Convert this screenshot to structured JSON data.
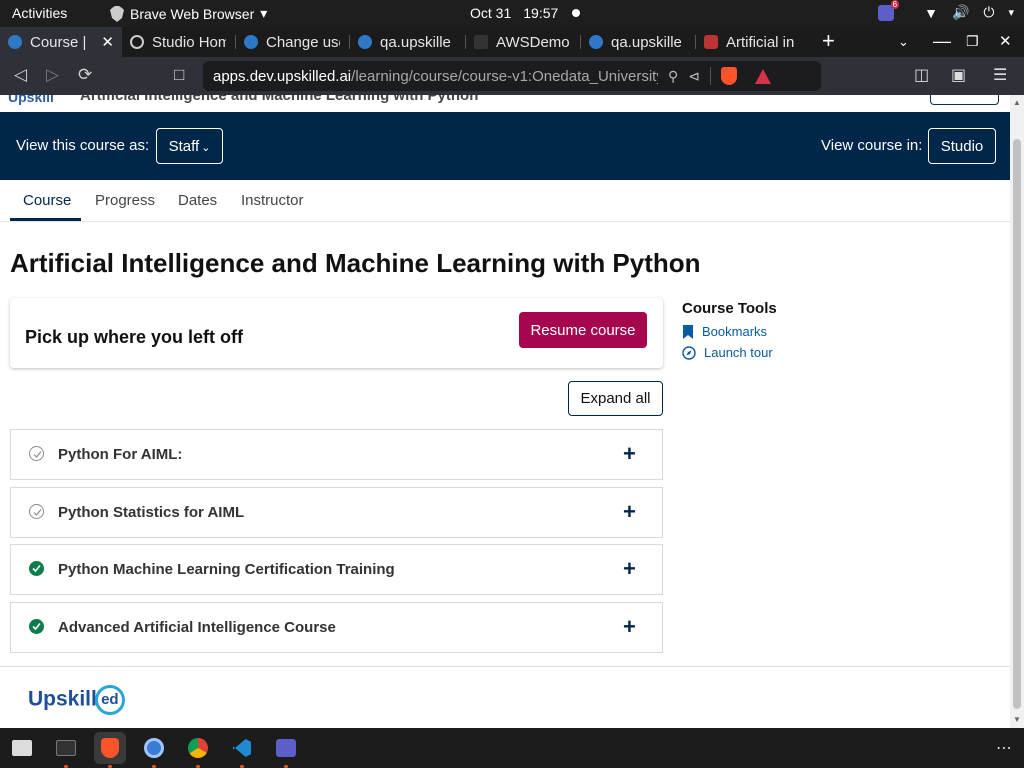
{
  "system": {
    "activities": "Activities",
    "app_name": "Brave Web Browser",
    "date": "Oct 31",
    "time": "19:57",
    "teams_badge": "6"
  },
  "browser": {
    "tabs": [
      {
        "title": "Course |",
        "active": true
      },
      {
        "title": "Studio Hom"
      },
      {
        "title": "Change use"
      },
      {
        "title": "qa.upskille"
      },
      {
        "title": "AWSDemo"
      },
      {
        "title": "qa.upskille"
      },
      {
        "title": "Artificial in"
      }
    ],
    "url_host": "apps.dev.upskilled.ai",
    "url_path": "/learning/course/course-v1:Onedata_University..."
  },
  "page": {
    "header_course_name": "Artificial Intelligence and Machine Learning with Python",
    "staff_bar": {
      "view_as_label": "View this course as:",
      "view_as_value": "Staff",
      "view_in_label": "View course in:",
      "studio_button": "Studio"
    },
    "tabs": [
      "Course",
      "Progress",
      "Dates",
      "Instructor"
    ],
    "title": "Artificial Intelligence and Machine Learning with Python",
    "resume_card": {
      "text": "Pick up where you left off",
      "button": "Resume course"
    },
    "expand_all": "Expand all",
    "sections": [
      {
        "name": "Python For AIML:",
        "complete": false
      },
      {
        "name": "Python Statistics for AIML",
        "complete": false
      },
      {
        "name": "Python Machine Learning Certification Training",
        "complete": true
      },
      {
        "name": "Advanced Artificial Intelligence Course",
        "complete": true
      }
    ],
    "course_tools": {
      "heading": "Course Tools",
      "items": [
        "Bookmarks",
        "Launch tour"
      ]
    },
    "footer_logo": "Upskill",
    "footer_logo_ed": "ed"
  },
  "colors": {
    "brand_navy": "#00264a",
    "resume_button": "#a5064e",
    "complete_check": "#0d7d4d",
    "link": "#0a5aa0"
  }
}
